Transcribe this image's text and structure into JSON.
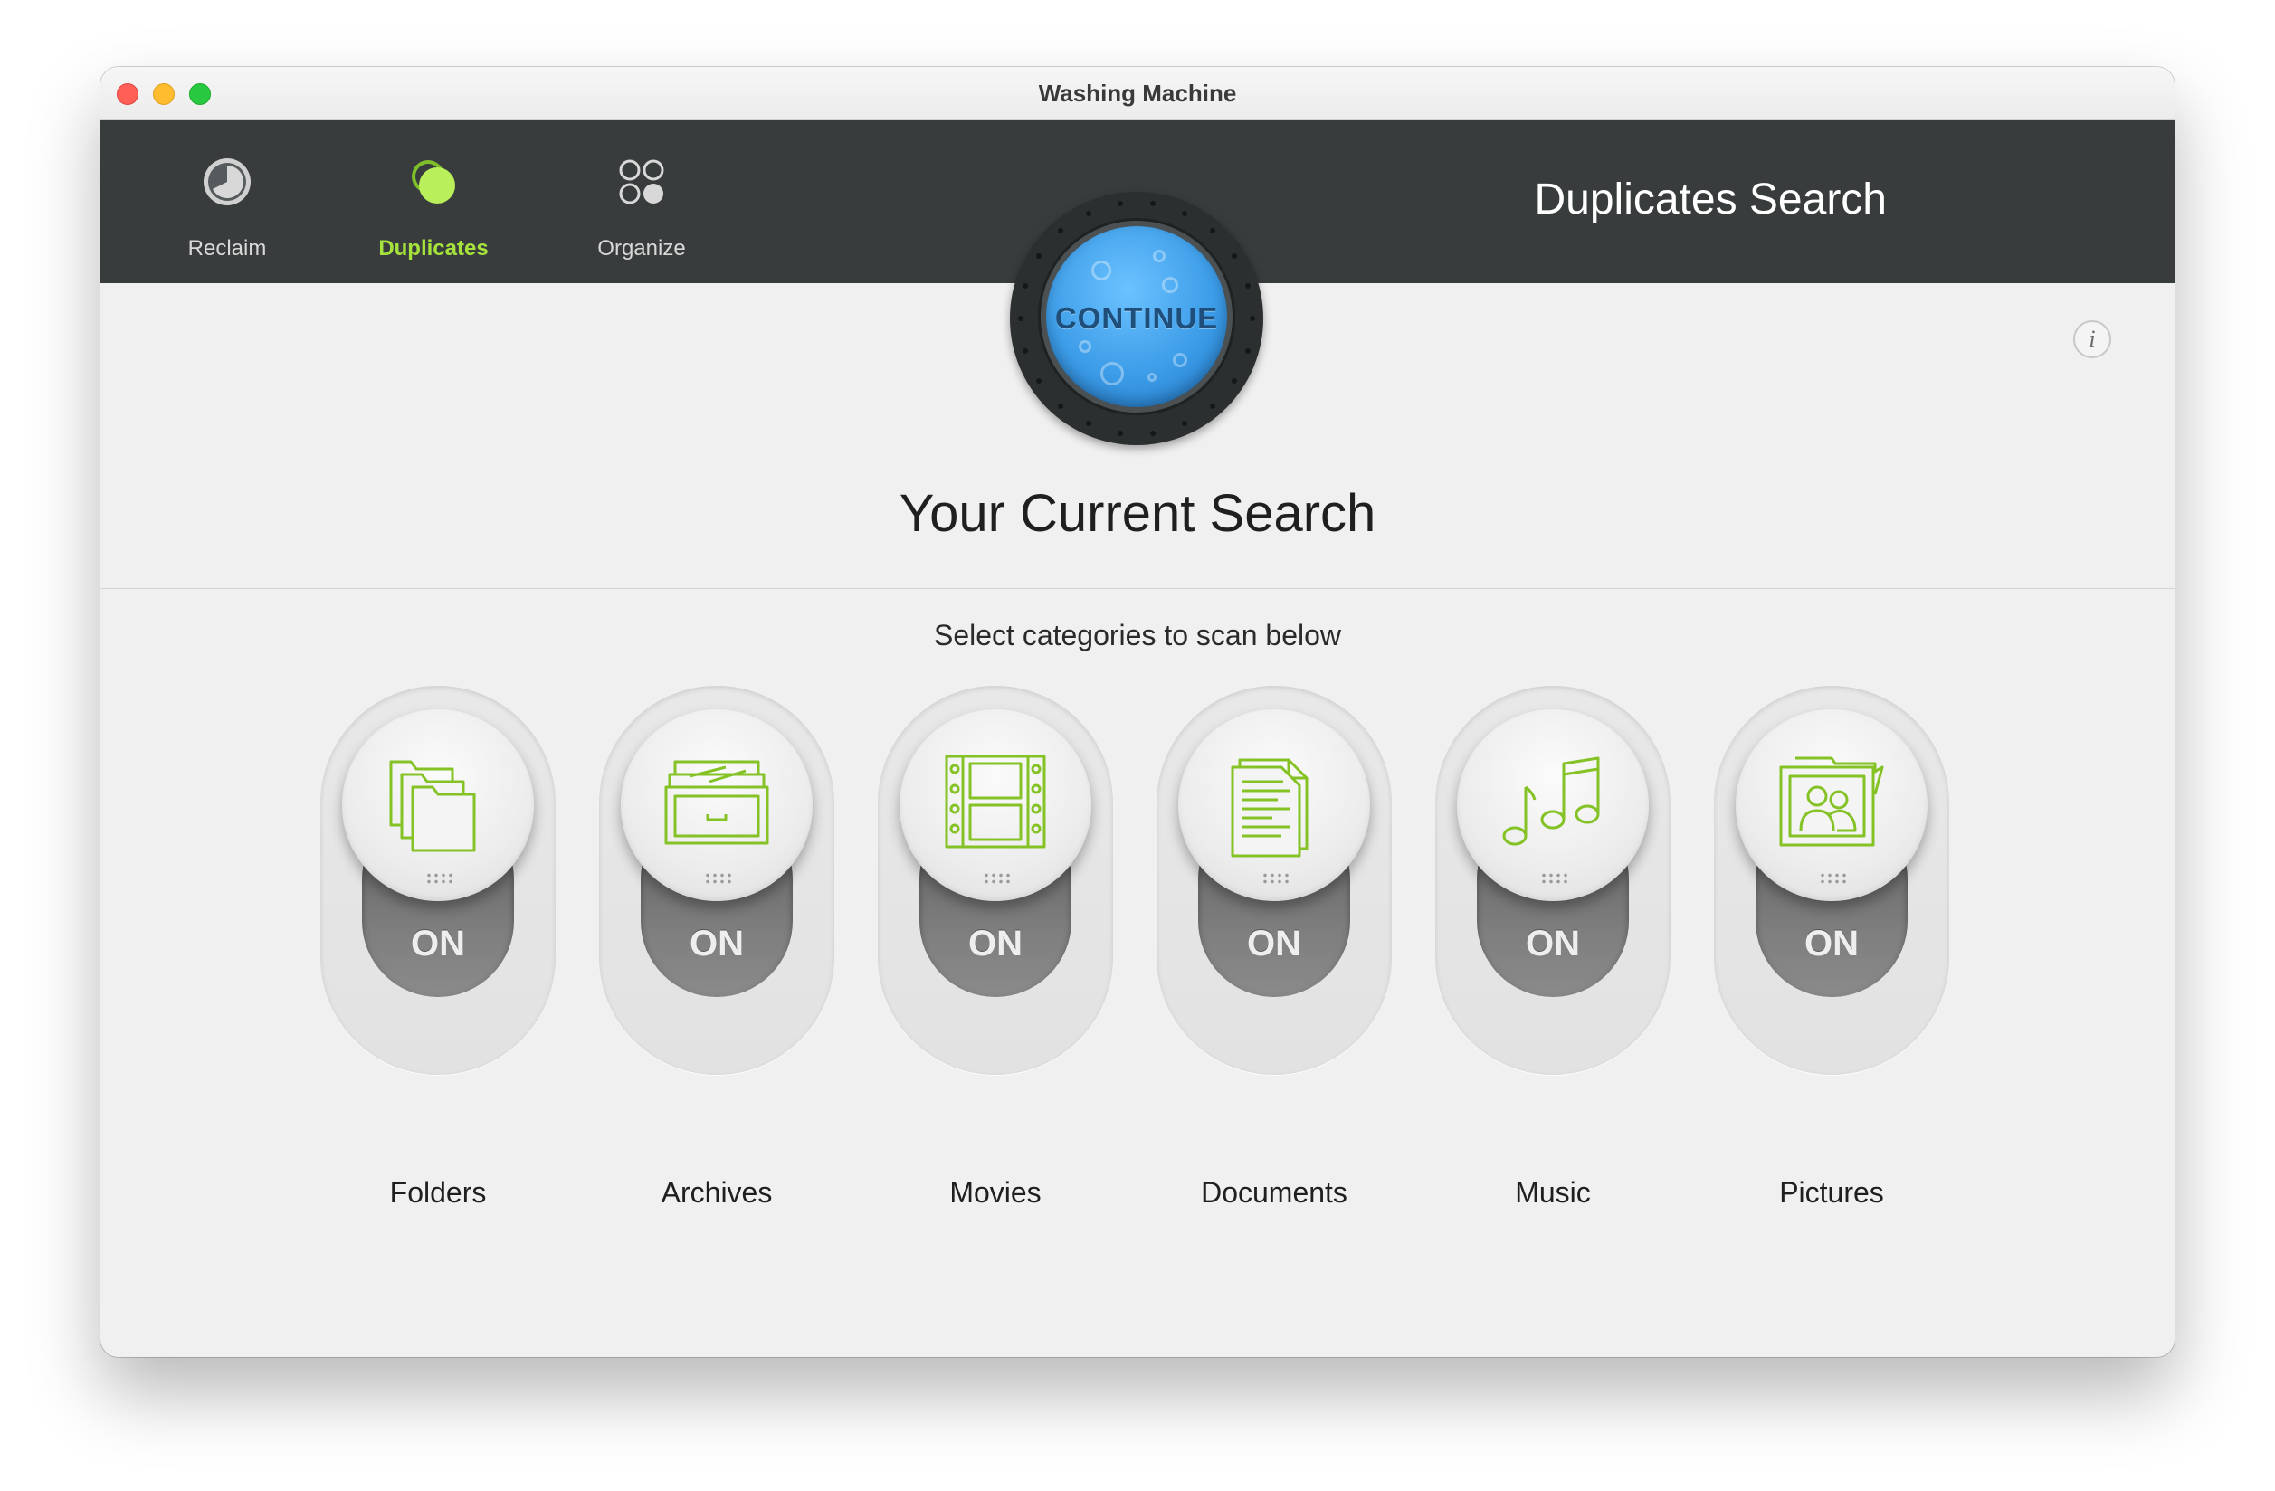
{
  "window": {
    "title": "Washing Machine"
  },
  "toolbar": {
    "tabs": [
      {
        "label": "Reclaim",
        "icon": "reclaim-clock-icon",
        "active": false
      },
      {
        "label": "Duplicates",
        "icon": "duplicates-bubbles-icon",
        "active": true
      },
      {
        "label": "Organize",
        "icon": "organize-circles-icon",
        "active": false
      }
    ],
    "heading": "Duplicates Search",
    "accent_color": "#a6e23c"
  },
  "continue_button": {
    "label": "CONTINUE",
    "color": "#3d9de8"
  },
  "info_button": {
    "label": "i"
  },
  "main": {
    "title": "Your Current Search",
    "subtitle": "Select categories to scan below"
  },
  "categories": [
    {
      "label": "Folders",
      "state": "ON",
      "icon": "folders-icon"
    },
    {
      "label": "Archives",
      "state": "ON",
      "icon": "archives-icon"
    },
    {
      "label": "Movies",
      "state": "ON",
      "icon": "movies-icon"
    },
    {
      "label": "Documents",
      "state": "ON",
      "icon": "documents-icon"
    },
    {
      "label": "Music",
      "state": "ON",
      "icon": "music-icon"
    },
    {
      "label": "Pictures",
      "state": "ON",
      "icon": "pictures-icon"
    }
  ]
}
